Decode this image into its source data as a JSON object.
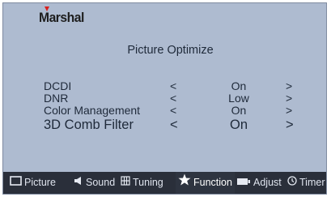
{
  "brand": {
    "logo": "Marshal"
  },
  "menu": {
    "title": "Picture Optimize",
    "rows": [
      {
        "label": "DCDI",
        "left": "<",
        "value": "On",
        "right": ">"
      },
      {
        "label": "DNR",
        "left": "<",
        "value": "Low",
        "right": ">"
      },
      {
        "label": "Color Management",
        "left": "<",
        "value": "On",
        "right": ">"
      },
      {
        "label": "3D Comb Filter",
        "left": "<",
        "value": "On",
        "right": ">"
      }
    ]
  },
  "tabs": [
    {
      "label": "Picture",
      "icon": "monitor-icon"
    },
    {
      "label": "Sound",
      "icon": "speaker-icon"
    },
    {
      "label": "Tuning",
      "icon": "grid-icon"
    },
    {
      "label": "Function",
      "icon": "star-icon",
      "active": true
    },
    {
      "label": "Adjust",
      "icon": "battery-icon"
    },
    {
      "label": "Timer",
      "icon": "clock-icon"
    }
  ],
  "colors": {
    "background": "#aebbd0",
    "bottom_bar": "#2a2f3a",
    "text": "#1f2a3a",
    "brand_accent": "#d8201d"
  }
}
